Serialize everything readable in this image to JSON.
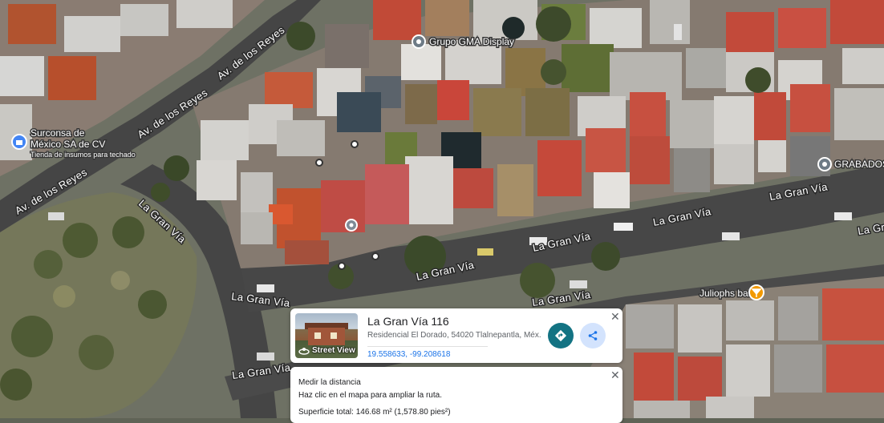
{
  "map": {
    "roads": [
      {
        "label": "Av. de los Reyes"
      },
      {
        "label": "Av. de los Reyes"
      },
      {
        "label": "Av. de los Reyes"
      },
      {
        "label": "La Gran Vía"
      },
      {
        "label": "La Gran Vía"
      },
      {
        "label": "La Gran Vía"
      },
      {
        "label": "La Gran Vía"
      },
      {
        "label": "La Gran Vía"
      },
      {
        "label": "La Gran Vía"
      },
      {
        "label": "La Gran Vía"
      },
      {
        "label": "La Gran"
      }
    ],
    "pois": [
      {
        "name": "Grupo GMA Display",
        "icon": "place-pin-icon"
      },
      {
        "name_line1": "Surconsa de",
        "name_line2": "México SA de CV",
        "subtitle": "Tienda de insumos para techado",
        "icon": "shopping-bag-pin-icon"
      },
      {
        "name": "GRABADOS",
        "icon": "place-pin-icon"
      },
      {
        "name": "Juliophs bar",
        "icon": "cocktail-pin-icon"
      }
    ]
  },
  "place_card": {
    "title": "La Gran Vía 116",
    "address": "Residencial El Dorado, 54020 Tlalnepantla, Méx.",
    "coordinates": "19.558633, -99.208618",
    "street_view_label": "Street View",
    "close": "✕",
    "directions_icon": "directions-icon",
    "share_icon": "share-icon"
  },
  "measure_card": {
    "title": "Medir la distancia",
    "hint": "Haz clic en el mapa para ampliar la ruta.",
    "area": "Superficie total: 146.68 m² (1,578.80 pies²)",
    "close": "✕"
  },
  "colors": {
    "accent": "#1a73e8",
    "directions_button": "#137383",
    "share_button_bg": "#d3e3fd",
    "bar_pin": "#f29900"
  }
}
